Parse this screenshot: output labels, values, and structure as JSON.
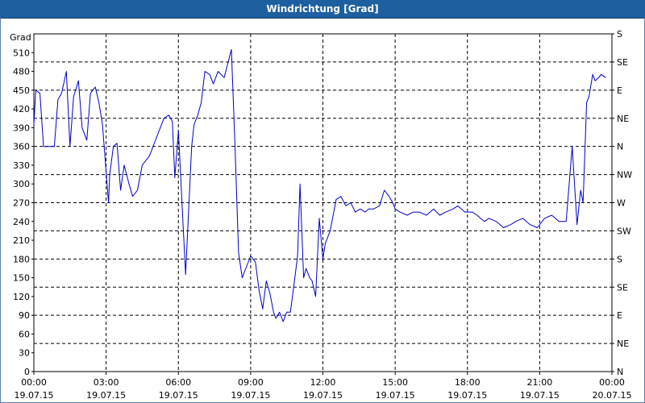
{
  "window": {
    "title": "Windrichtung [Grad]"
  },
  "chart_data": {
    "type": "line",
    "title": "Windrichtung [Grad]",
    "ylabel": "Grad",
    "ylim": [
      0,
      540
    ],
    "xlim_hours": [
      0,
      24
    ],
    "grid": true,
    "line_color": "#0000cc",
    "y_ticks": [
      0,
      30,
      60,
      90,
      120,
      150,
      180,
      210,
      240,
      270,
      300,
      330,
      360,
      390,
      420,
      450,
      480,
      510
    ],
    "right_ticks": [
      {
        "value": 0,
        "label": "N"
      },
      {
        "value": 45,
        "label": "NE"
      },
      {
        "value": 90,
        "label": "E"
      },
      {
        "value": 135,
        "label": "SE"
      },
      {
        "value": 180,
        "label": "S"
      },
      {
        "value": 225,
        "label": "SW"
      },
      {
        "value": 270,
        "label": "W"
      },
      {
        "value": 315,
        "label": "NW"
      },
      {
        "value": 360,
        "label": "N"
      },
      {
        "value": 405,
        "label": "NE"
      },
      {
        "value": 450,
        "label": "E"
      },
      {
        "value": 495,
        "label": "SE"
      },
      {
        "value": 540,
        "label": "S"
      }
    ],
    "x_ticks": [
      {
        "hour": 0,
        "time": "00:00",
        "date": "19.07.15"
      },
      {
        "hour": 3,
        "time": "03:00",
        "date": "19.07.15"
      },
      {
        "hour": 6,
        "time": "06:00",
        "date": "19.07.15"
      },
      {
        "hour": 9,
        "time": "09:00",
        "date": "19.07.15"
      },
      {
        "hour": 12,
        "time": "12:00",
        "date": "19.07.15"
      },
      {
        "hour": 15,
        "time": "15:00",
        "date": "19.07.15"
      },
      {
        "hour": 18,
        "time": "18:00",
        "date": "19.07.15"
      },
      {
        "hour": 21,
        "time": "21:00",
        "date": "19.07.15"
      },
      {
        "hour": 24,
        "time": "00:00",
        "date": "20.07.15"
      }
    ],
    "series": [
      {
        "x_hours": [
          0.0,
          0.08,
          0.25,
          0.4,
          0.6,
          0.85,
          1.0,
          1.15,
          1.35,
          1.5,
          1.65,
          1.85,
          2.0,
          2.2,
          2.35,
          2.55,
          2.7,
          2.85,
          3.0,
          3.1,
          3.15,
          3.3,
          3.45,
          3.6,
          3.75,
          3.95,
          4.1,
          4.3,
          4.5,
          4.8,
          5.1,
          5.4,
          5.6,
          5.75,
          5.85,
          6.0,
          6.15,
          6.3,
          6.55,
          6.65,
          6.8,
          6.95,
          7.1,
          7.3,
          7.45,
          7.65,
          7.9,
          8.2,
          8.35,
          8.5,
          8.65,
          8.8,
          9.0,
          9.2,
          9.35,
          9.5,
          9.65,
          9.8,
          9.95,
          10.05,
          10.2,
          10.35,
          10.5,
          10.65,
          10.8,
          10.95,
          11.05,
          11.2,
          11.3,
          11.45,
          11.55,
          11.7,
          11.85,
          12.0,
          12.1,
          12.3,
          12.55,
          12.75,
          12.95,
          13.15,
          13.35,
          13.55,
          13.75,
          13.9,
          14.1,
          14.35,
          14.55,
          14.75,
          14.9,
          15.0,
          15.2,
          15.5,
          15.75,
          16.0,
          16.3,
          16.6,
          16.85,
          17.1,
          17.4,
          17.6,
          17.9,
          18.2,
          18.4,
          18.7,
          18.9,
          19.2,
          19.5,
          19.8,
          20.0,
          20.3,
          20.6,
          20.9,
          21.2,
          21.5,
          21.8,
          22.1,
          22.35,
          22.55,
          22.7,
          22.8,
          22.95,
          23.05,
          23.2,
          23.3,
          23.45,
          23.55,
          23.75,
          23.9,
          24.0
        ],
        "values": [
          395,
          450,
          445,
          360,
          360,
          360,
          435,
          445,
          480,
          360,
          440,
          465,
          390,
          370,
          445,
          455,
          430,
          395,
          320,
          270,
          315,
          360,
          365,
          290,
          330,
          300,
          280,
          290,
          330,
          345,
          375,
          405,
          410,
          400,
          310,
          385,
          270,
          155,
          360,
          395,
          410,
          430,
          480,
          475,
          460,
          480,
          470,
          515,
          360,
          190,
          150,
          165,
          185,
          175,
          130,
          100,
          145,
          125,
          95,
          85,
          95,
          80,
          95,
          95,
          140,
          185,
          300,
          150,
          165,
          150,
          145,
          120,
          245,
          180,
          205,
          225,
          275,
          280,
          265,
          270,
          255,
          260,
          255,
          260,
          260,
          265,
          290,
          280,
          270,
          260,
          255,
          250,
          255,
          255,
          250,
          260,
          250,
          255,
          260,
          265,
          255,
          255,
          250,
          240,
          245,
          240,
          230,
          235,
          240,
          245,
          235,
          230,
          245,
          250,
          240,
          240,
          360,
          235,
          290,
          270,
          430,
          440,
          475,
          465,
          470,
          475,
          470
        ]
      }
    ]
  }
}
